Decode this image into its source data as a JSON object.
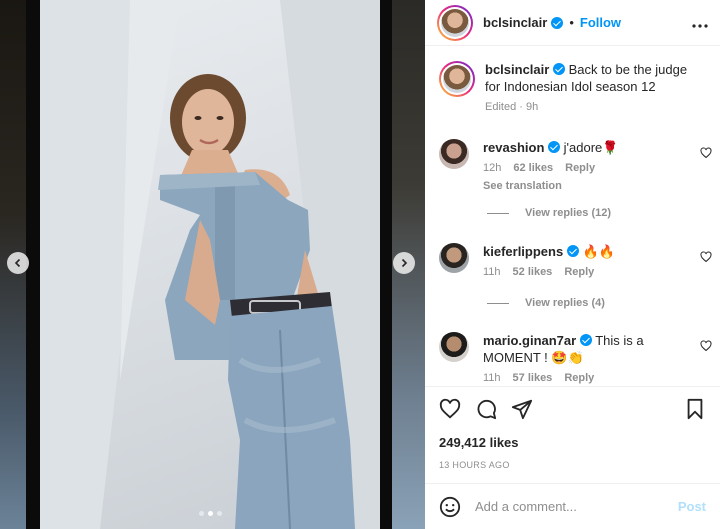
{
  "post": {
    "author": "bclsinclair",
    "follow_label": "Follow",
    "separator": "•",
    "more_label": "•••",
    "caption": "Back to be the judge for Indonesian Idol season 12",
    "caption_meta": "Edited · 9h",
    "likes": "249,412 likes",
    "time_ago": "13 HOURS AGO",
    "carousel": {
      "count": 3,
      "active": 1
    }
  },
  "comments": [
    {
      "user": "revashion",
      "text": "j'adore🌹",
      "time": "12h",
      "likes": "62 likes",
      "reply": "Reply",
      "see_translation": "See translation",
      "view_replies": "View replies (12)"
    },
    {
      "user": "kieferlippens",
      "text": "🔥🔥",
      "time": "11h",
      "likes": "52 likes",
      "reply": "Reply",
      "view_replies": "View replies (4)"
    },
    {
      "user": "mario.ginan7ar",
      "text": "This is a MOMENT ! 🤩👏",
      "time": "11h",
      "likes": "57 likes",
      "reply": "Reply"
    }
  ],
  "add_comment": {
    "placeholder": "Add a comment...",
    "post_label": "Post"
  },
  "icons": {
    "prev": "chevron-left-icon",
    "next": "chevron-right-icon",
    "like": "heart-icon",
    "comment": "comment-icon",
    "share": "share-icon",
    "save": "bookmark-icon",
    "emoji": "smiley-icon",
    "more": "more-icon"
  },
  "colors": {
    "link": "#0095f6",
    "muted": "#8e8e8e",
    "text": "#262626",
    "post_disabled": "#b2dffc"
  }
}
